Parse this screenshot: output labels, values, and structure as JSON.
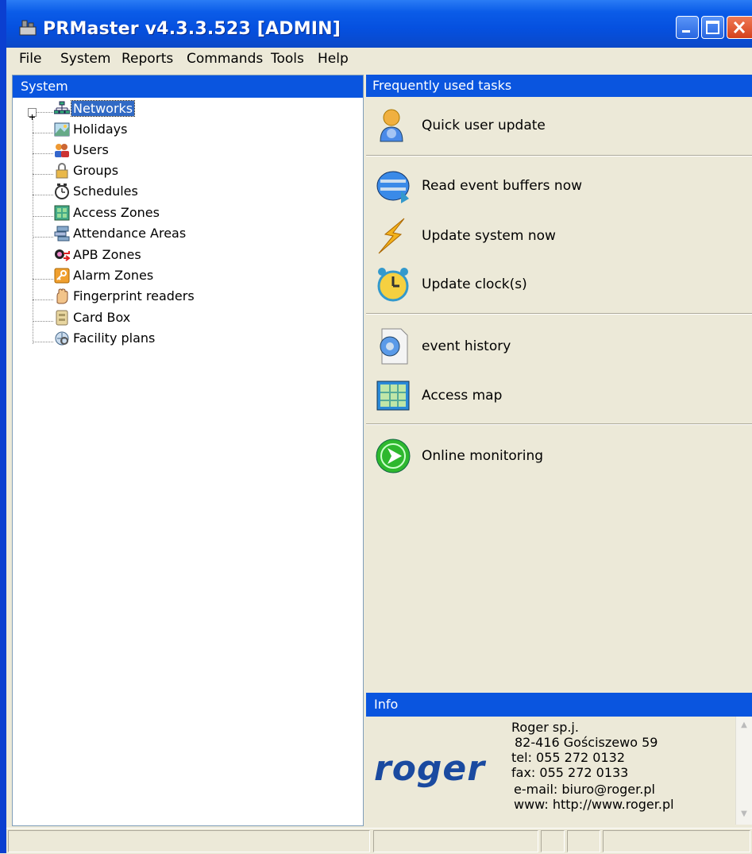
{
  "window": {
    "title": "PRMaster v4.3.3.523 [ADMIN]"
  },
  "menu": [
    "File",
    "System",
    "Reports",
    "Commands",
    "Tools",
    "Help"
  ],
  "left_panel": {
    "header": "System",
    "tree": [
      {
        "label": "Networks",
        "icon": "networks-icon",
        "selected": true
      },
      {
        "label": "Holidays",
        "icon": "holidays-icon"
      },
      {
        "label": "Users",
        "icon": "users-icon"
      },
      {
        "label": "Groups",
        "icon": "groups-icon"
      },
      {
        "label": "Schedules",
        "icon": "schedules-icon"
      },
      {
        "label": "Access Zones",
        "icon": "access-zones-icon"
      },
      {
        "label": "Attendance Areas",
        "icon": "attendance-areas-icon"
      },
      {
        "label": "APB Zones",
        "icon": "apb-zones-icon"
      },
      {
        "label": "Alarm Zones",
        "icon": "alarm-zones-icon"
      },
      {
        "label": "Fingerprint readers",
        "icon": "fingerprint-icon"
      },
      {
        "label": "Card Box",
        "icon": "card-box-icon"
      },
      {
        "label": "Facility plans",
        "icon": "facility-plans-icon"
      }
    ]
  },
  "tasks_panel": {
    "header": "Frequently used tasks",
    "tasks": [
      {
        "label": "Quick user update",
        "icon": "user-update-icon"
      },
      {
        "label": "Read event buffers now",
        "icon": "read-events-icon"
      },
      {
        "label": "Update system now",
        "icon": "lightning-icon"
      },
      {
        "label": "Update clock(s)",
        "icon": "clock-icon"
      },
      {
        "label": "event history",
        "icon": "event-history-icon"
      },
      {
        "label": "Access map",
        "icon": "access-map-icon"
      },
      {
        "label": "Online monitoring",
        "icon": "online-monitoring-icon"
      }
    ]
  },
  "info_panel": {
    "header": "Info",
    "logo": "roger",
    "lines": [
      "Roger sp.j.",
      "82-416 Gościszewo 59",
      "tel: 055 272 0132",
      "fax: 055 272 0133",
      "e-mail: biuro@roger.pl",
      "www: http://www.roger.pl"
    ]
  },
  "colors": {
    "titlebar": "#0550df",
    "panel_header": "#0a55df",
    "selection": "#316ac5",
    "face": "#ece9d8"
  }
}
